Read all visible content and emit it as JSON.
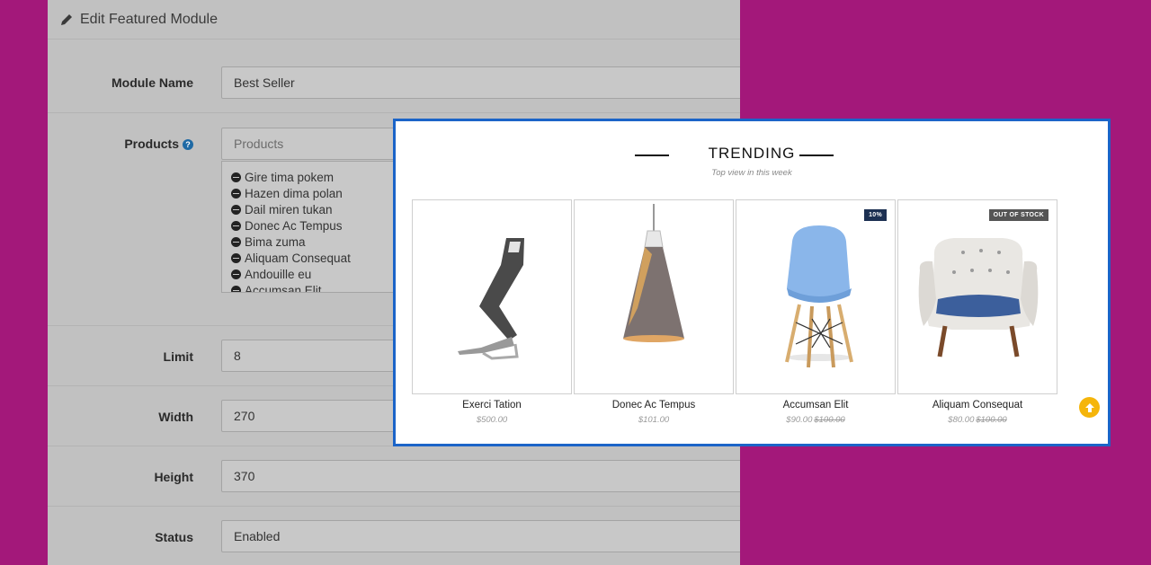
{
  "admin": {
    "header_title": "Edit Featured Module",
    "module_name_label": "Module Name",
    "module_name_value": "Best Seller",
    "products_label": "Products",
    "products_placeholder": "Products",
    "products": [
      "Gire tima pokem",
      "Hazen dima polan",
      "Dail miren tukan",
      "Donec Ac Tempus",
      "Bima zuma",
      "Aliquam Consequat",
      "Andouille eu",
      "Accumsan Elit"
    ],
    "limit_label": "Limit",
    "limit_value": "8",
    "width_label": "Width",
    "width_value": "270",
    "height_label": "Height",
    "height_value": "370",
    "status_label": "Status",
    "status_value": "Enabled"
  },
  "trending": {
    "title": "TRENDING",
    "subtitle": "Top view in this week",
    "products": [
      {
        "name": "Exerci Tation",
        "price": "$500.00",
        "old_price": "",
        "badge": ""
      },
      {
        "name": "Donec Ac Tempus",
        "price": "$101.00",
        "old_price": "",
        "badge": ""
      },
      {
        "name": "Accumsan Elit",
        "price": "$90.00",
        "old_price": "$100.00",
        "badge": "10%"
      },
      {
        "name": "Aliquam Consequat",
        "price": "$80.00",
        "old_price": "$100.00",
        "badge": "OUT OF STOCK"
      }
    ]
  },
  "colors": {
    "background": "#a3187a",
    "card_border": "#1b64c8",
    "scroll_top": "#f5b50b"
  },
  "icons": [
    "pencil-icon",
    "help-icon",
    "remove-item-icon",
    "scroll-top-icon"
  ]
}
